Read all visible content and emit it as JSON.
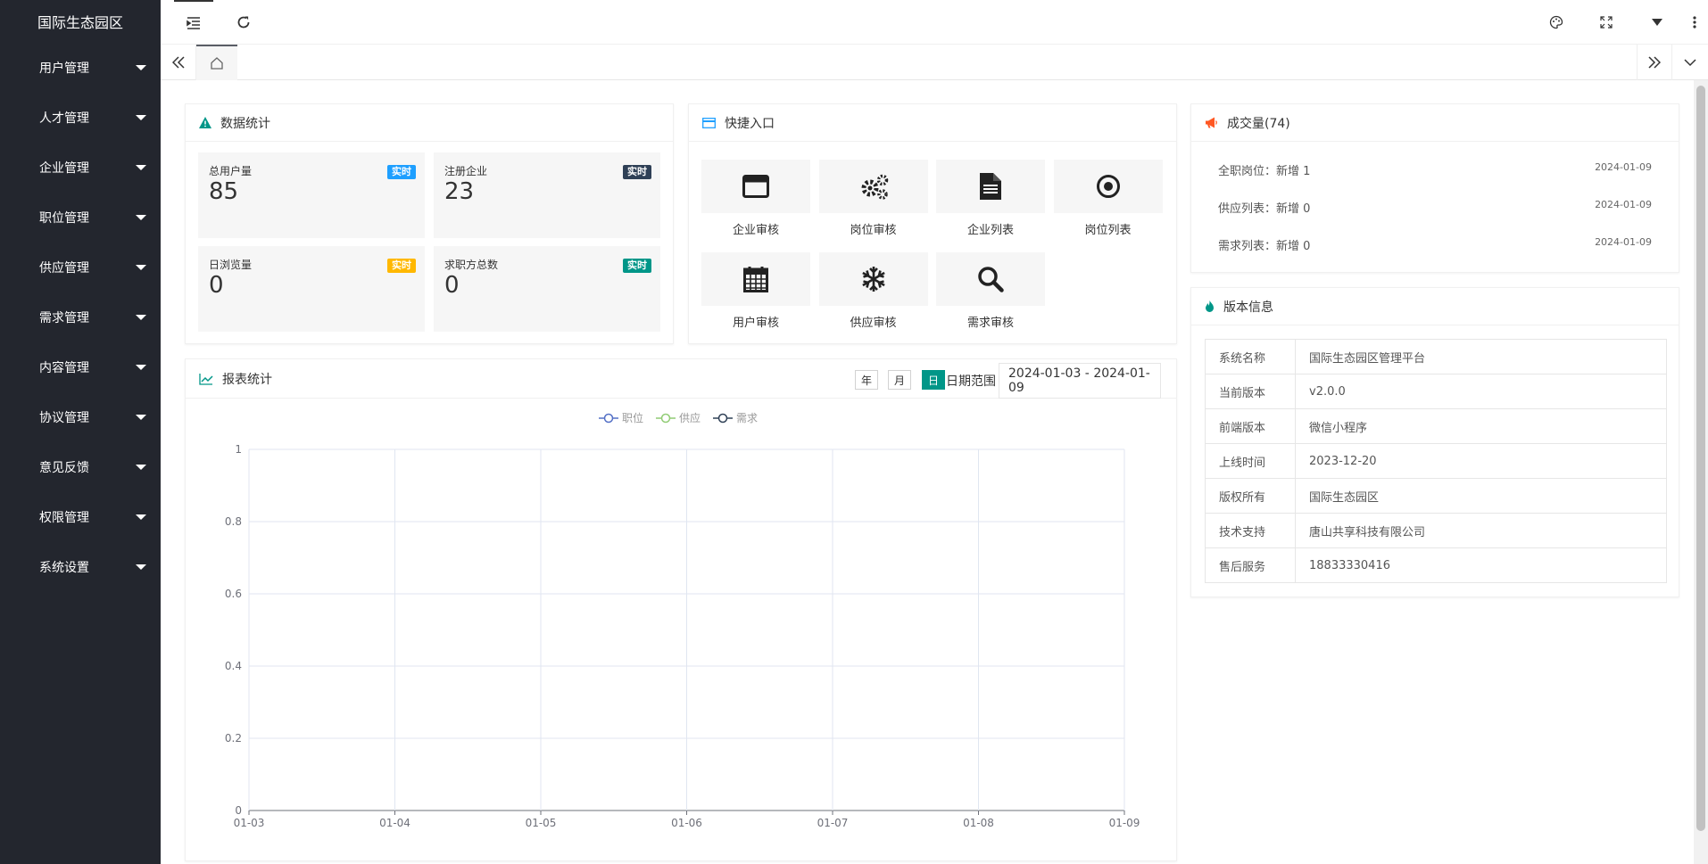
{
  "app": {
    "title": "国际生态园区"
  },
  "sidebar": {
    "items": [
      {
        "label": "用户管理"
      },
      {
        "label": "人才管理"
      },
      {
        "label": "企业管理"
      },
      {
        "label": "职位管理"
      },
      {
        "label": "供应管理"
      },
      {
        "label": "需求管理"
      },
      {
        "label": "内容管理"
      },
      {
        "label": "协议管理"
      },
      {
        "label": "意见反馈"
      },
      {
        "label": "权限管理"
      },
      {
        "label": "系统设置"
      }
    ]
  },
  "stats": {
    "title": "数据统计",
    "items": [
      {
        "label": "总用户量",
        "value": "85",
        "badge": "实时",
        "badge_color": "#1e9fff"
      },
      {
        "label": "注册企业",
        "value": "23",
        "badge": "实时",
        "badge_color": "#2f4056"
      },
      {
        "label": "日浏览量",
        "value": "0",
        "badge": "实时",
        "badge_color": "#ffb800"
      },
      {
        "label": "求职方总数",
        "value": "0",
        "badge": "实时",
        "badge_color": "#009688"
      }
    ]
  },
  "quick": {
    "title": "快捷入口",
    "items": [
      {
        "label": "企业审核",
        "icon": "window-icon"
      },
      {
        "label": "岗位审核",
        "icon": "gears-icon"
      },
      {
        "label": "企业列表",
        "icon": "file-icon"
      },
      {
        "label": "岗位列表",
        "icon": "target-icon"
      },
      {
        "label": "用户审核",
        "icon": "calendar-icon"
      },
      {
        "label": "供应审核",
        "icon": "snowflake-icon"
      },
      {
        "label": "需求审核",
        "icon": "search-icon"
      }
    ]
  },
  "report": {
    "title": "报表统计",
    "btn_year": "年",
    "btn_month": "月",
    "btn_day": "日",
    "range_label": "日期范围",
    "date_range": "2024-01-03 - 2024-01-09"
  },
  "chart_data": {
    "type": "line",
    "x": [
      "01-03",
      "01-04",
      "01-05",
      "01-06",
      "01-07",
      "01-08",
      "01-09"
    ],
    "yticks": [
      "0",
      "0.2",
      "0.4",
      "0.6",
      "0.8",
      "1"
    ],
    "ylim": [
      0,
      1
    ],
    "grid": true,
    "legend_position": "top",
    "series": [
      {
        "name": "职位",
        "color": "#5470c6",
        "values": [
          0,
          0,
          0,
          0,
          0,
          0,
          0
        ]
      },
      {
        "name": "供应",
        "color": "#91cc75",
        "values": [
          0,
          0,
          0,
          0,
          0,
          0,
          0
        ]
      },
      {
        "name": "需求",
        "color": "#2f4056",
        "values": [
          0,
          0,
          0,
          0,
          0,
          0,
          0
        ]
      }
    ]
  },
  "deals": {
    "title": "成交量(74)",
    "items": [
      {
        "text": "全职岗位：新增 1",
        "date": "2024-01-09"
      },
      {
        "text": "供应列表：新增 0",
        "date": "2024-01-09"
      },
      {
        "text": "需求列表：新增 0",
        "date": "2024-01-09"
      }
    ]
  },
  "version": {
    "title": "版本信息",
    "rows": [
      {
        "key": "系统名称",
        "value": "国际生态园区管理平台"
      },
      {
        "key": "当前版本",
        "value": "v2.0.0"
      },
      {
        "key": "前端版本",
        "value": "微信小程序"
      },
      {
        "key": "上线时间",
        "value": "2023-12-20"
      },
      {
        "key": "版权所有",
        "value": "国际生态园区"
      },
      {
        "key": "技术支持",
        "value": "唐山共享科技有限公司"
      },
      {
        "key": "售后服务",
        "value": "18833330416"
      }
    ]
  }
}
